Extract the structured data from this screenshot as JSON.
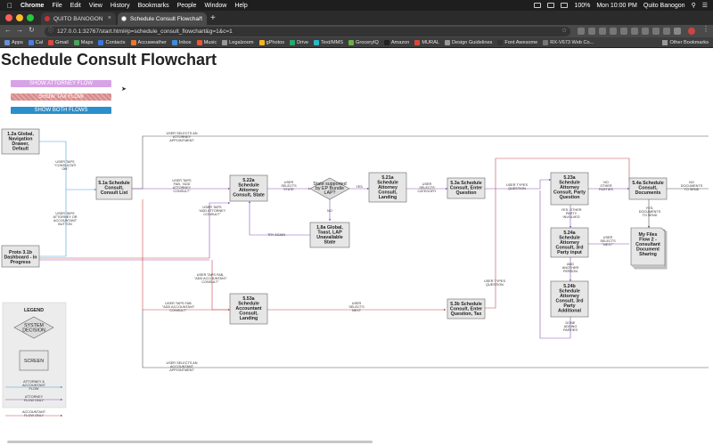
{
  "menubar": {
    "app": "Chrome",
    "items": [
      "File",
      "Edit",
      "View",
      "History",
      "Bookmarks",
      "People",
      "Window",
      "Help"
    ],
    "battery": "100%",
    "clock": "Mon 10:00 PM",
    "user": "Quito Banogon"
  },
  "tabs": [
    {
      "label": "QUITO BANOGON"
    },
    {
      "label": "Schedule Consult Flowchart"
    }
  ],
  "address": {
    "url": "127.0.0.1:32767/start.html#p=schedule_consult_flowchart&g=1&c=1"
  },
  "bookmarks": {
    "items": [
      "Apps",
      "Cal",
      "Gmail",
      "Maps",
      "Contacts",
      "Accuweather",
      "Inbox",
      "Music",
      "Legalzoom",
      "gPhotos",
      "Drive",
      "Text/MMS",
      "GroceryIQ",
      "Amazon",
      "MURAL",
      "Design Guidelines",
      "Font Awesome",
      "RX-V673 Web Co..."
    ],
    "other": "Other Bookmarks"
  },
  "page": {
    "title": "Schedule Consult Flowchart",
    "buttons": {
      "attorney": "SHOW ATTORNEY FLOW",
      "tax": "SHOW TAX FLOW",
      "both": "SHOW BOTH FLOWS"
    }
  },
  "flow": {
    "nodes": {
      "global_nav": [
        "1.2a Global,",
        "Navigation",
        "Drawer,",
        "Default"
      ],
      "proto_dashboard": [
        "Proto 3.1b",
        "Dashboard - in",
        "Progress"
      ],
      "consult_list": [
        "5.1a Schedule",
        "Consult,",
        "Consult List"
      ],
      "attorney_state": [
        "5.22a",
        "Schedule",
        "Attorney",
        "Consult, State"
      ],
      "state_supported": [
        "State supported",
        "by EP Bundle",
        "LAP?"
      ],
      "unavailable": [
        "1.8a Global,",
        "Toast, LAP",
        "Unavailable",
        "State"
      ],
      "attorney_landing": [
        "5.21a",
        "Schedule",
        "Attorney",
        "Consult,",
        "Landing"
      ],
      "enter_question": [
        "5.3a Schedule",
        "Consult, Enter",
        "Question"
      ],
      "party_question": [
        "5.23a",
        "Schedule",
        "Attorney",
        "Consult, Party",
        "Question"
      ],
      "documents": [
        "5.4a Schedule",
        "Consult,",
        "Documents"
      ],
      "third_party_input": [
        "5.24a",
        "Schedule",
        "Attorney",
        "Consult, 3rd",
        "Party input"
      ],
      "my_files": [
        "My Files",
        "Flow 2 -",
        "Consultant",
        "Document",
        "Sharing"
      ],
      "third_party_additional": [
        "5.24b",
        "Schedule",
        "Attorney",
        "Consult, 3rd",
        "Party",
        "Additional"
      ],
      "accountant_landing": [
        "5.53a",
        "Schedule",
        "Accountant",
        "Consult,",
        "Landing"
      ],
      "enter_question_tax": [
        "5.3b Schedule",
        "Consult, Enter",
        "Question, Tax"
      ]
    },
    "labels": {
      "selects_attorney_top": [
        "USER SELECTS AN",
        "ATTORNEY",
        "APPOINTMENT"
      ],
      "taps_consult_on": [
        "USER TAPS",
        "\"CONSULTATI",
        "ON\""
      ],
      "taps_button": [
        "USER TAPS",
        "ATTORNEY OR",
        "ACCOUNTANT",
        "BUTTON"
      ],
      "fab_add_attorney": [
        "USER TAPS",
        "FAB, \"ADD",
        "ATTORNEY",
        "CONSULT\""
      ],
      "add_attorney": [
        "USER TAPS",
        "\"ADD ATTORNEY",
        "CONSULT\""
      ],
      "selects_state": [
        "USER",
        "SELECTS",
        "STATE"
      ],
      "yes": "YES",
      "no": "NO",
      "try_again": "TRY AGAIN",
      "selects_category": [
        "USER",
        "SELECTS",
        "CATEGORY"
      ],
      "types_question": [
        "USER TYPES",
        "QUESTION"
      ],
      "no_other_parties": [
        "NO",
        "OTHER",
        "PARTIES"
      ],
      "no_documents": [
        "NO",
        "DOCUMENTS",
        "TO SEND"
      ],
      "yes_other_party": [
        "YES, OTHER",
        "PARTY",
        "INVOLVED"
      ],
      "yes_documents": [
        "YES,",
        "DOCUMENTS",
        "TO SEND"
      ],
      "selects_next": [
        "USER",
        "SELECTS",
        "\"NEXT\""
      ],
      "add_another": [
        "ADD",
        "ANOTHER",
        "PERSON"
      ],
      "done_adding": [
        "DONE",
        "ADDING",
        "PARTIES"
      ],
      "fab_add_accountant": [
        "USER TAPS FAB,",
        "\"ADD ACCOUNTANT",
        "CONSULT\""
      ],
      "add_accountant": [
        "USER TAPS FAB",
        "\"ADD ACCOUNTANT",
        "CONSULT\""
      ],
      "selects_next_tax": [
        "USER",
        "SELECTS",
        "NEXT"
      ],
      "types_question_tax": [
        "USER TYPES",
        "QUESTION"
      ],
      "selects_accountant_bottom": [
        "USER SELECTS AN",
        "ACCOUNTANT",
        "APPOINTMENT"
      ]
    },
    "legend": {
      "title": "LEGEND",
      "decision": [
        "SYSTEM",
        "DECISION"
      ],
      "screen": "SCREEN",
      "both_flow": [
        "ATTORNEY &",
        "ACCOUNTANT",
        "FLOW"
      ],
      "attorney_flow": [
        "ATTORNEY",
        "FLOW ONLY"
      ],
      "accountant_flow": [
        "ACCOUNTANT",
        "FLOW ONLY"
      ]
    }
  },
  "colors": {
    "both_flow": "#4a9fd8",
    "attorney_flow": "#8a55b8",
    "accountant_flow": "#c8484b",
    "neutral": "#555555"
  }
}
